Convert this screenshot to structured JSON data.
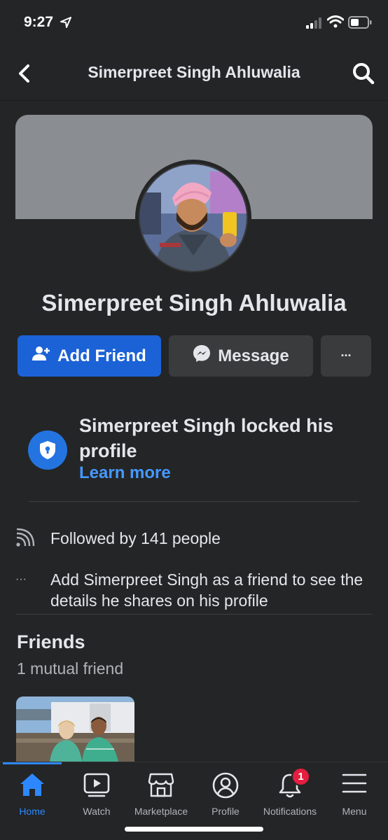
{
  "status_bar": {
    "time": "9:27"
  },
  "header": {
    "title": "Simerpreet Singh Ahluwalia"
  },
  "profile": {
    "name": "Simerpreet Singh Ahluwalia",
    "add_friend_label": "Add Friend",
    "message_label": "Message",
    "more_label": "···"
  },
  "locked": {
    "text": "Simerpreet Singh locked his profile",
    "learn_more": "Learn more"
  },
  "info": {
    "followers": "Followed by 141 people",
    "add_prompt": "Add Simerpreet Singh as a friend to see the details he shares on his profile",
    "more_glyph": "···"
  },
  "friends": {
    "title": "Friends",
    "subtitle": "1 mutual friend"
  },
  "tabs": [
    {
      "label": "Home",
      "icon": "home-icon",
      "active": true
    },
    {
      "label": "Watch",
      "icon": "watch-icon"
    },
    {
      "label": "Marketplace",
      "icon": "marketplace-icon"
    },
    {
      "label": "Profile",
      "icon": "profile-icon"
    },
    {
      "label": "Notifications",
      "icon": "bell-icon",
      "badge": "1"
    },
    {
      "label": "Menu",
      "icon": "menu-icon"
    }
  ],
  "colors": {
    "background": "#242526",
    "primary_button": "#1b62d6",
    "secondary_button": "#3a3b3c",
    "link": "#4599ff",
    "badge": "#e41e3f",
    "active_tab": "#2d88ff"
  }
}
